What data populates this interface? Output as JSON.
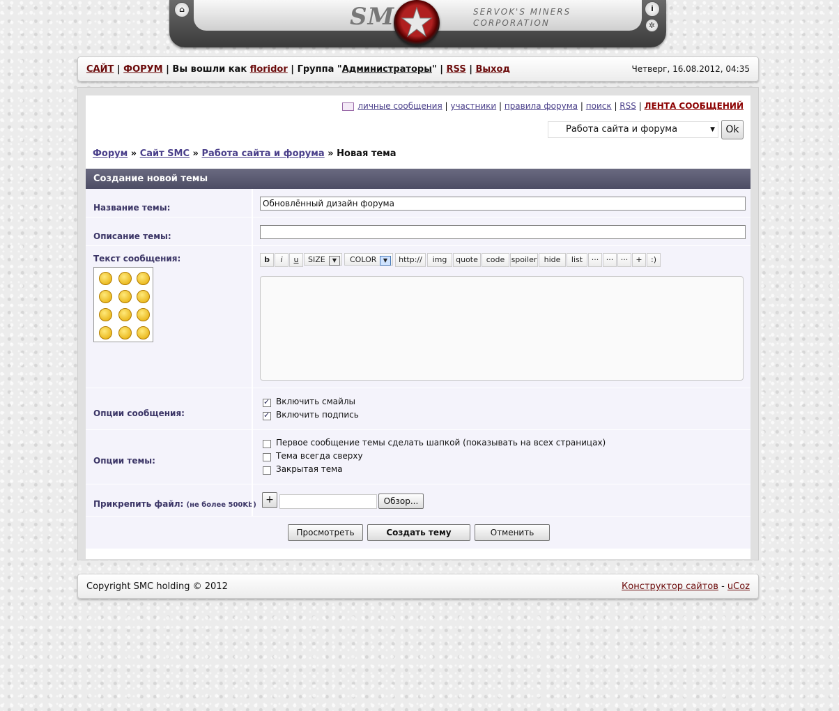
{
  "logo": {
    "name": "SMC",
    "subtitle_line1": "SERVOK'S MINERS",
    "subtitle_line2": "CORPORATION",
    "home_icon": "home-icon",
    "info_icon": "info-icon",
    "tools_icon": "tools-icon"
  },
  "topbar": {
    "site": "САЙТ",
    "forum": "ФОРУМ",
    "logged_in_as": "Вы вошли как",
    "user": "floridor",
    "group_label": "Группа",
    "group": "Администраторы",
    "rss": "RSS",
    "logout": "Выход",
    "datetime": "Четверг, 16.08.2012, 04:35"
  },
  "toplinks": {
    "messages": "личные сообщения",
    "members": "участники",
    "rules": "правила форума",
    "search": "поиск",
    "rss": "RSS",
    "feed": "ЛЕНТА СООБЩЕНИЙ"
  },
  "forum_select": {
    "value": "Работа сайта и форума",
    "ok": "Ok"
  },
  "breadcrumb": {
    "forum": "Форум",
    "site": "Сайт SMC",
    "section": "Работа сайта и форума",
    "current": "Новая тема"
  },
  "form": {
    "header": "Создание новой темы",
    "title_label": "Название темы:",
    "title_value": "Обновлённый дизайн форума",
    "desc_label": "Описание темы:",
    "desc_value": "",
    "text_label": "Текст сообщения:",
    "toolbar": {
      "bold": "b",
      "italic": "i",
      "underline": "u",
      "size": "SIZE",
      "color": "COLOR",
      "url": "http://",
      "img": "img",
      "quote": "quote",
      "code": "code",
      "spoiler": "spoiler",
      "hide": "hide",
      "list": "list",
      "more1": "···",
      "more2": "···",
      "more3": "···",
      "plus": "+",
      "smile": ":)"
    },
    "msg_options_label": "Опции сообщения:",
    "enable_smilies": "Включить смайлы",
    "enable_signature": "Включить подпись",
    "topic_options_label": "Опции темы:",
    "pin_first": "Первое сообщение темы сделать шапкой (показывать на всех страницах)",
    "always_top": "Тема всегда сверху",
    "closed": "Закрытая тема",
    "attach_label": "Прикрепить файл:",
    "attach_note": "(не более 500Kb)",
    "attach_plus": "+",
    "browse": "Обзор...",
    "preview": "Просмотреть",
    "create": "Создать тему",
    "cancel": "Отменить"
  },
  "footer": {
    "copyright": "Copyright SMC holding © 2012",
    "builder": "Конструктор сайтов",
    "dash": "-",
    "ucoz": "uCoz"
  }
}
